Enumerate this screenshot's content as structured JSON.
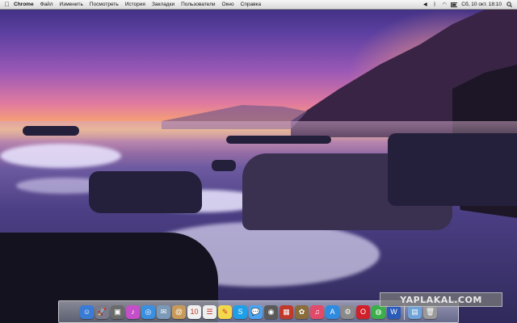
{
  "menubar": {
    "apple_label": "",
    "app_name": "Chrome",
    "items": [
      "Файл",
      "Изменить",
      "Посмотреть",
      "История",
      "Закладки",
      "Пользователи",
      "Окно",
      "Справка"
    ],
    "status": {
      "volume_icon": "volume-icon",
      "bluetooth_icon": "bluetooth-icon",
      "wifi_icon": "wifi-icon",
      "battery_icon": "battery-icon",
      "clock": "Сб, 10 окт. 18:10",
      "spotlight_icon": "spotlight-icon"
    }
  },
  "dock": {
    "apps": [
      {
        "icon": "finder-icon",
        "color": "#3a7bd5",
        "glyph": "☺"
      },
      {
        "icon": "launchpad-icon",
        "color": "#7a7a8a",
        "glyph": "🚀"
      },
      {
        "icon": "photo-icon",
        "color": "#6b6b6b",
        "glyph": "▣"
      },
      {
        "icon": "itunes-store-icon",
        "color": "#c44fc8",
        "glyph": "♪"
      },
      {
        "icon": "safari-icon",
        "color": "#3b8fe0",
        "glyph": "◎"
      },
      {
        "icon": "mail-icon",
        "color": "#7c9ab8",
        "glyph": "✉"
      },
      {
        "icon": "contacts-icon",
        "color": "#c79a5a",
        "glyph": "@"
      },
      {
        "icon": "calendar-icon",
        "color": "#f0f0f0",
        "glyph": "10"
      },
      {
        "icon": "reminders-icon",
        "color": "#eeeeee",
        "glyph": "☰"
      },
      {
        "icon": "notes-icon",
        "color": "#f2d84a",
        "glyph": "✎"
      },
      {
        "icon": "skype-icon",
        "color": "#1ea0e8",
        "glyph": "S"
      },
      {
        "icon": "messages-icon",
        "color": "#4aa3f0",
        "glyph": "💬"
      },
      {
        "icon": "facetime-icon",
        "color": "#5a5a5a",
        "glyph": "◉"
      },
      {
        "icon": "photo-booth-icon",
        "color": "#c0392b",
        "glyph": "▦"
      },
      {
        "icon": "iphoto-icon",
        "color": "#8a6d3b",
        "glyph": "✿"
      },
      {
        "icon": "itunes-icon",
        "color": "#e24a6a",
        "glyph": "♫"
      },
      {
        "icon": "app-store-icon",
        "color": "#2f8be0",
        "glyph": "A"
      },
      {
        "icon": "system-preferences-icon",
        "color": "#8a8a8a",
        "glyph": "⚙"
      },
      {
        "icon": "opera-icon",
        "color": "#d0202a",
        "glyph": "O"
      },
      {
        "icon": "chrome-icon",
        "color": "#3cae4a",
        "glyph": "◍"
      },
      {
        "icon": "word-icon",
        "color": "#2a5bb8",
        "glyph": "W"
      }
    ],
    "extras": [
      {
        "icon": "downloads-folder-icon",
        "color": "#6fa3d8",
        "glyph": "▤"
      },
      {
        "icon": "trash-icon",
        "color": "#9a9a9a",
        "glyph": "🗑"
      }
    ]
  },
  "watermark": {
    "text": "YAPLAKAL.COM"
  }
}
